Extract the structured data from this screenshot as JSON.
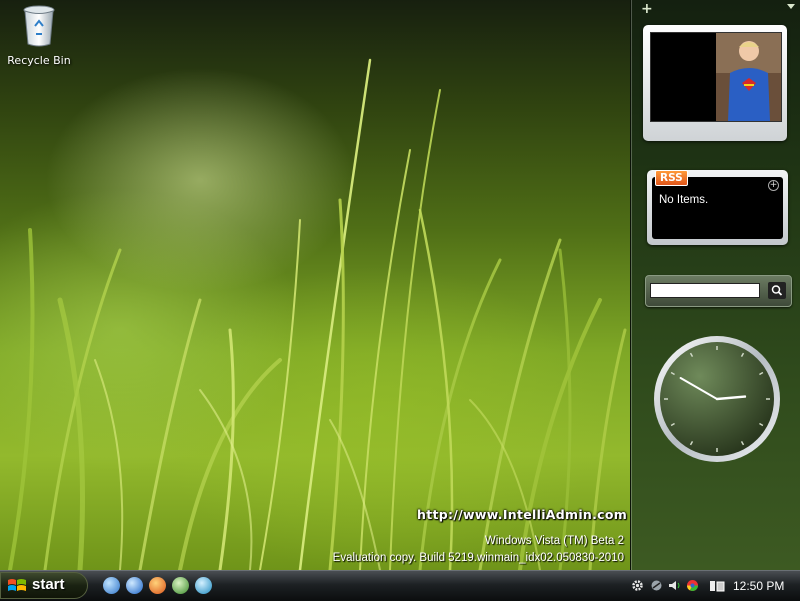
{
  "desktop": {
    "icons": [
      {
        "label": "Recycle Bin",
        "icon": "recycle-bin-icon"
      }
    ],
    "watermark": {
      "url": "http://www.IntelliAdmin.com",
      "line1": "Windows Vista (TM) Beta 2",
      "line2": "Evaluation copy. Build 5219.winmain_idx02.050830-2010"
    }
  },
  "sidebar": {
    "add_gadget": "+",
    "gadgets": {
      "slideshow": {
        "icon": "slideshow-photo"
      },
      "rss": {
        "badge": "RSS",
        "text": "No Items."
      },
      "search": {
        "value": "",
        "icon": "search-icon"
      },
      "clock": {
        "hour": 2,
        "minute": 50
      }
    }
  },
  "taskbar": {
    "start_label": "start",
    "quick_launch": [
      "explorer-icon",
      "internet-explorer-icon",
      "firefox-icon",
      "media-icon",
      "search-icon"
    ],
    "tray_icons": [
      "gear-icon",
      "network-icon",
      "speaker-icon",
      "chrome-like-icon",
      "power-icon"
    ],
    "clock": "12:50 PM"
  }
}
